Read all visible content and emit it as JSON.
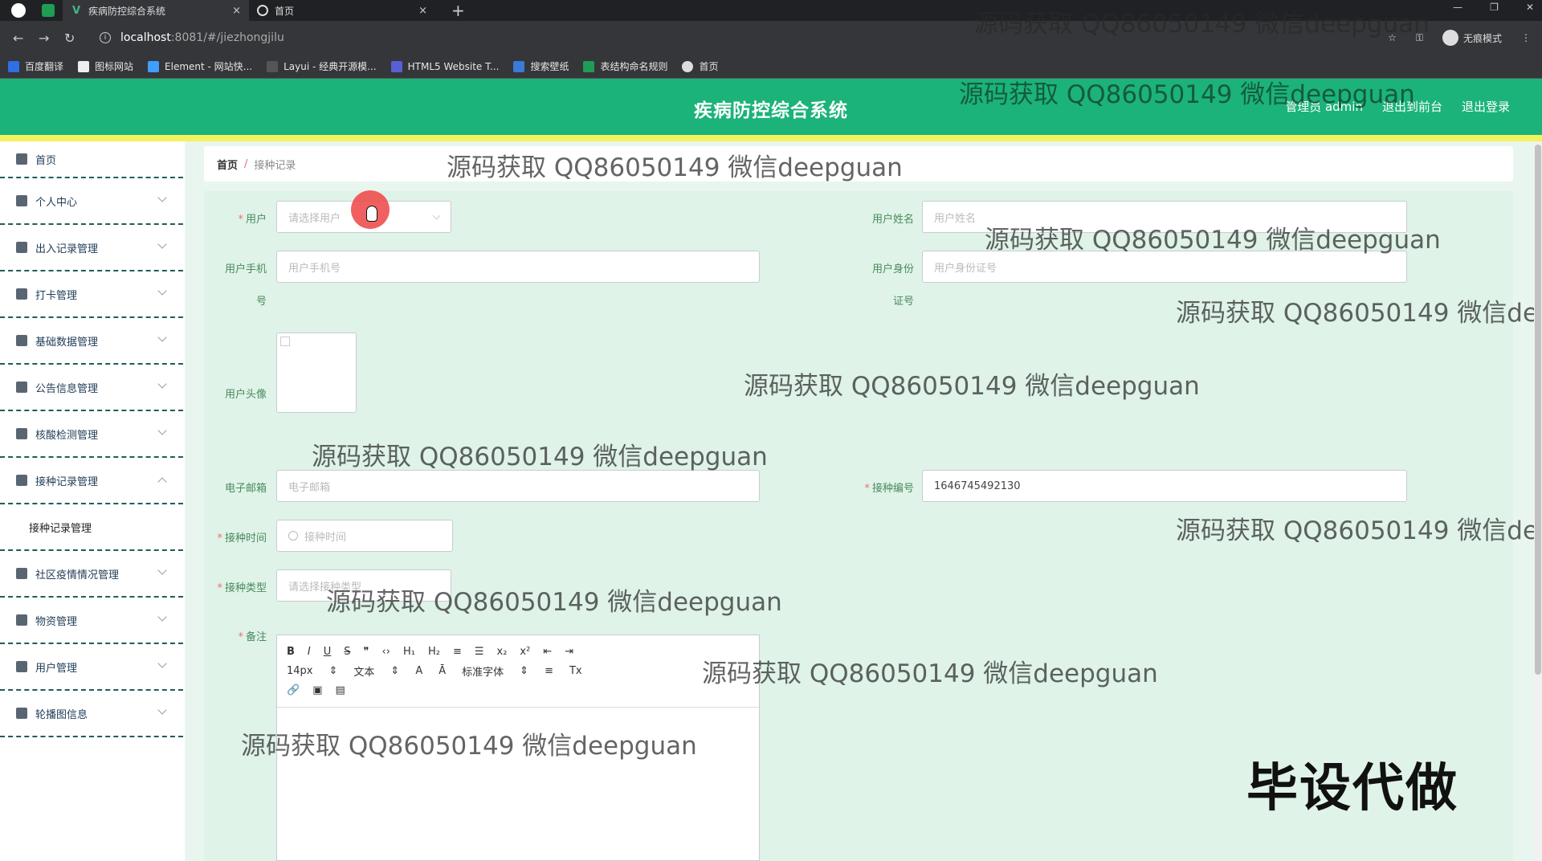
{
  "browser": {
    "tabs": [
      {
        "title": "疾病防控综合系统",
        "close": "×"
      },
      {
        "title": "首页",
        "close": "×"
      }
    ],
    "new_tab": "+",
    "url_host": "localhost",
    "url_path": ":8081/#/jiezhongjilu",
    "incognito_label": "无痕模式",
    "bookmarks": [
      "百度翻译",
      "图标网站",
      "Element - 网站快...",
      "Layui - 经典开源模...",
      "HTML5 Website T...",
      "搜索壁纸",
      "表结构命名规则",
      "首页"
    ]
  },
  "header": {
    "title": "疾病防控综合系统",
    "admin": "管理员 admin",
    "to_front": "退出到前台",
    "logout": "退出登录"
  },
  "sidebar": {
    "items": [
      {
        "label": "首页"
      },
      {
        "label": "个人中心"
      },
      {
        "label": "出入记录管理"
      },
      {
        "label": "打卡管理"
      },
      {
        "label": "基础数据管理"
      },
      {
        "label": "公告信息管理"
      },
      {
        "label": "核酸检测管理"
      },
      {
        "label": "接种记录管理"
      },
      {
        "label": "接种记录管理"
      },
      {
        "label": "社区疫情情况管理"
      },
      {
        "label": "物资管理"
      },
      {
        "label": "用户管理"
      },
      {
        "label": "轮播图信息"
      }
    ]
  },
  "breadcrumb": {
    "home": "首页",
    "sep": "/",
    "current": "接种记录"
  },
  "form": {
    "user_label": "用户",
    "user_placeholder": "请选择用户",
    "name_label": "用户姓名",
    "name_placeholder": "用户姓名",
    "phone_label": "用户手机",
    "phone_label_wrap": "号",
    "phone_placeholder": "用户手机号",
    "idcard_label": "用户身份",
    "idcard_label_wrap": "证号",
    "idcard_placeholder": "用户身份证号",
    "avatar_label": "用户头像",
    "email_label": "电子邮箱",
    "email_placeholder": "电子邮箱",
    "vacc_no_label": "接种编号",
    "vacc_no_value": "1646745492130",
    "vacc_time_label": "接种时间",
    "vacc_time_placeholder": "接种时间",
    "vacc_type_label": "接种类型",
    "vacc_type_placeholder": "请选择接种类型",
    "remark_label": "备注"
  },
  "editor": {
    "row1": [
      "B",
      "I",
      "U",
      "S",
      "❞",
      "‹›",
      "H₁",
      "H₂",
      "≡",
      "☰",
      "x₂",
      "x²",
      "⇤",
      "⇥"
    ],
    "font_size": "14px",
    "text_style": "文本",
    "font_family": "标准字体",
    "row3": [
      "🔗",
      "▣",
      "▤"
    ]
  },
  "watermarks": [
    "源码获取 QQ86050149 微信deepguan"
  ],
  "big_mark": "毕设代做"
}
